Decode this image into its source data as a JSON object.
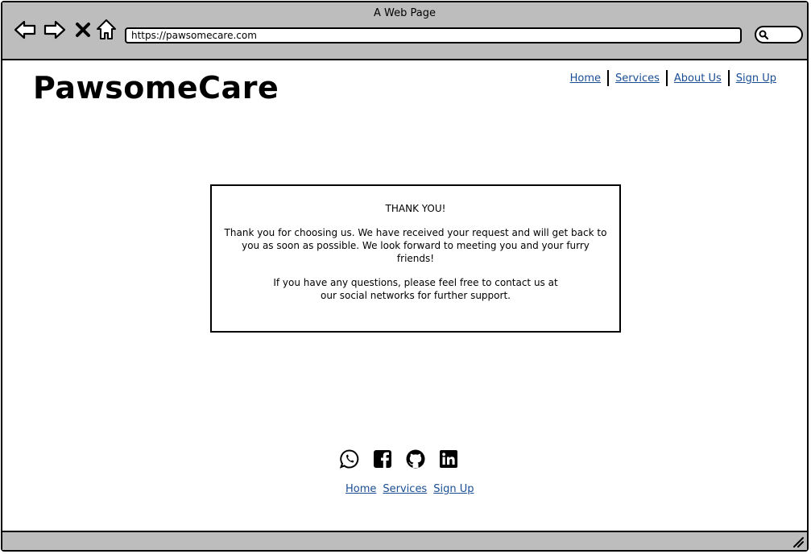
{
  "browser": {
    "title": "A Web Page",
    "url": "https://pawsomecare.com"
  },
  "header": {
    "logo": "PawsomeCare",
    "nav": [
      {
        "label": "Home"
      },
      {
        "label": "Services"
      },
      {
        "label": "About Us"
      },
      {
        "label": "Sign Up"
      }
    ]
  },
  "message": {
    "heading": "THANK YOU!",
    "paragraph1": "Thank you for choosing us. We have received your request and will get back to you as soon as possible. We look forward to meeting you and your furry friends!",
    "paragraph2": "If you have any questions, please feel free to contact us at our social networks for further support."
  },
  "footer": {
    "social": [
      "whatsapp-icon",
      "facebook-icon",
      "github-icon",
      "linkedin-icon"
    ],
    "nav": [
      {
        "label": "Home"
      },
      {
        "label": "Services"
      },
      {
        "label": "Sign Up"
      }
    ]
  },
  "colors": {
    "chrome": "#bdbdbd",
    "link": "#1a4e94"
  }
}
